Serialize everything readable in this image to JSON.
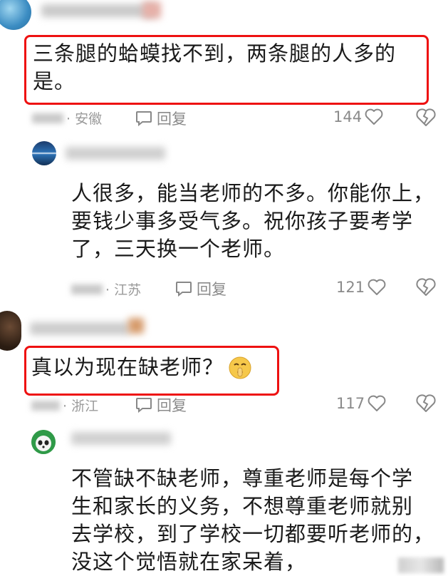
{
  "comments": [
    {
      "text_lines": [
        "三条腿的蛤蟆找不到，两条腿的人多的",
        "是。"
      ],
      "location": "· 安徽",
      "reply_label": "回复",
      "likes": "144"
    },
    {
      "text_lines": [
        "人很多，能当老师的不多。你能你上，",
        "要钱少事多受气多。祝你孩子要考学",
        "了，三天换一个老师。"
      ],
      "location": "· 江苏",
      "reply_label": "回复",
      "likes": "121"
    },
    {
      "text": "真以为现在缺老师？",
      "location": "· 浙江",
      "reply_label": "回复",
      "likes": "117"
    },
    {
      "text_lines": [
        "不管缺不缺老师，尊重老师是每个学",
        "生和家长的义务，不想尊重老师就别",
        "去学校，到了学校一切都要听老师的，",
        "没这个觉悟就在家呆着，"
      ]
    }
  ],
  "colors": {
    "highlight_border": "#e11111",
    "meta_gray": "#9a9a9a"
  },
  "icons": [
    "comment-bubble-icon",
    "heart-icon",
    "broken-heart-icon",
    "shushing-face-emoji"
  ]
}
